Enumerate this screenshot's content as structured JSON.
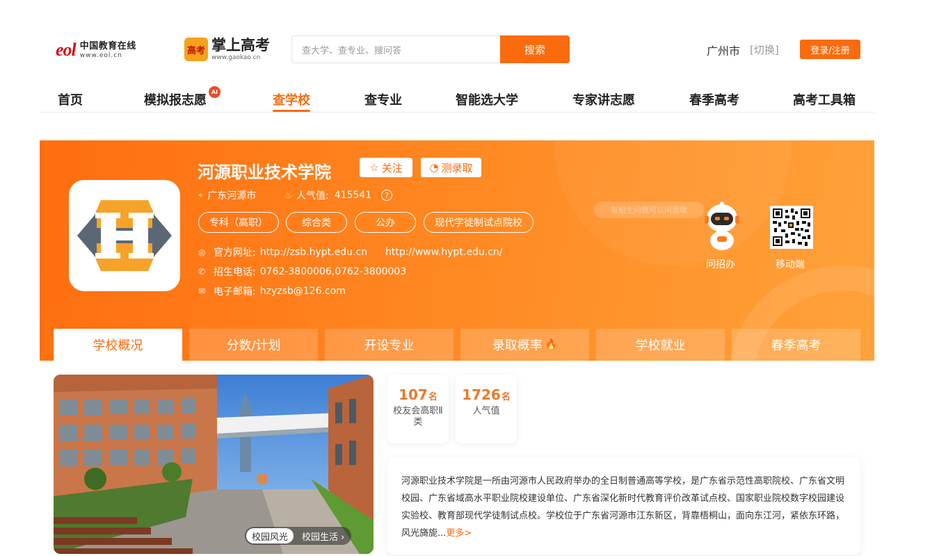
{
  "header": {
    "eol_mark": "eol",
    "eol_name": "中国教育在线",
    "eol_url": "www.eol.cn",
    "gk_badge": "高考",
    "gk_name": "掌上高考",
    "gk_url": "www.gaokao.cn",
    "search_placeholder": "查大学、查专业、搜问答",
    "search_button": "搜索",
    "city": "广州市",
    "city_switch": "[切换]",
    "login_button": "登录/注册"
  },
  "nav": {
    "items": [
      "首页",
      "模拟报志愿",
      "查学校",
      "查专业",
      "智能选大学",
      "专家讲志愿",
      "春季高考",
      "高考工具箱"
    ],
    "ai_badge": "AI",
    "active_index": 2
  },
  "school": {
    "name": "河源职业技术学院",
    "follow_label": "关注",
    "predict_label": "测录取",
    "location": "广东河源市",
    "popularity_label": "人气值:",
    "popularity_value": "415541",
    "tags": [
      "专科（高职）",
      "综合类",
      "公办",
      "现代学徒制试点院校"
    ],
    "website_label": "官方网址:",
    "website_1": "http://zsb.hypt.edu.cn",
    "website_2": "http://www.hypt.edu.cn/",
    "phone_label": "招生电话:",
    "phone_value": "0762-3800006,0762-3800003",
    "email_label": "电子邮箱:",
    "email_value": "hzyzsb@126.com",
    "ask_bubble": "有招生问题可以问我哦",
    "ask_label": "问招办",
    "mobile_label": "移动端"
  },
  "tabs": [
    "学校概况",
    "分数/计划",
    "开设专业",
    "录取概率",
    "学校就业",
    "春季高考"
  ],
  "campus": {
    "pill_active": "校园风光",
    "pill_other": "校园生活 ›"
  },
  "stats": [
    {
      "value": "107",
      "unit": "名",
      "label": "校友会高职Ⅱ类"
    },
    {
      "value": "1726",
      "unit": "名",
      "label": "人气值"
    }
  ],
  "intro": {
    "text": "河源职业技术学院是一所由河源市人民政府举办的全日制普通高等学校，是广东省示范性高职院校、广东省文明校园、广东省域高水平职业院校建设单位、广东省深化新时代教育评价改革试点校、国家职业院校数字校园建设实验校、教育部现代学徒制试点校。学校位于广东省河源市江东新区，背靠梧桐山，面向东江河，紧依东环路，风光旖旎...",
    "more": "更多>"
  },
  "colors": {
    "accent": "#fa6b0d",
    "banner_start": "#ff6d0f",
    "banner_end": "#ffa23a"
  }
}
